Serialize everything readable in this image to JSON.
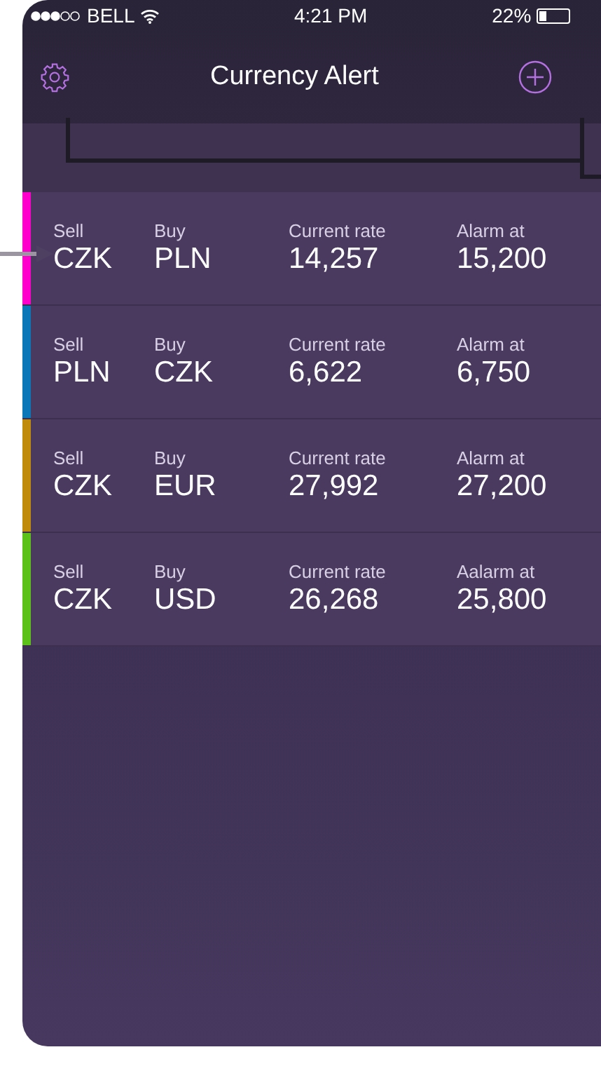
{
  "status_bar": {
    "carrier": "BELL",
    "time": "4:21 PM",
    "battery": "22%"
  },
  "nav_bar": {
    "title": "Currency Alert"
  },
  "alerts": [
    {
      "color": "#ff00cc",
      "sell_label": "Sell",
      "sell": "CZK",
      "buy_label": "Buy",
      "buy": "PLN",
      "rate_label": "Current rate",
      "rate": "14,257",
      "alarm_label": "Alarm at",
      "alarm": "15,200"
    },
    {
      "color": "#0a78b8",
      "sell_label": "Sell",
      "sell": "PLN",
      "buy_label": "Buy",
      "buy": "CZK",
      "rate_label": "Current rate",
      "rate": "6,622",
      "alarm_label": "Alarm at",
      "alarm": "6,750"
    },
    {
      "color": "#c08a0a",
      "sell_label": "Sell",
      "sell": "CZK",
      "buy_label": "Buy",
      "buy": "EUR",
      "rate_label": "Current rate",
      "rate": "27,992",
      "alarm_label": "Alarm at",
      "alarm": "27,200"
    },
    {
      "color": "#5cc21a",
      "sell_label": "Sell",
      "sell": "CZK",
      "buy_label": "Buy",
      "buy": "USD",
      "rate_label": "Current rate",
      "rate": "26,268",
      "alarm_label": "Aalarm at",
      "alarm": "25,800"
    }
  ]
}
